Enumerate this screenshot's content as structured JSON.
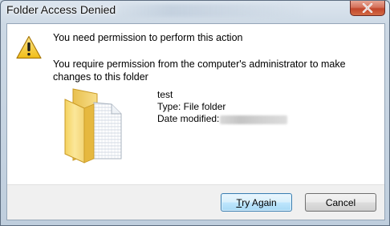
{
  "window": {
    "title": "Folder Access Denied"
  },
  "dialog": {
    "heading": "You need permission to perform this action",
    "message": "You require permission from the computer's administrator to make changes to this folder"
  },
  "item": {
    "name": "test",
    "type_label": "Type: File folder",
    "date_modified_label": "Date modified:",
    "date_modified_value_redacted": true
  },
  "buttons": {
    "try_again_accel": "T",
    "try_again_rest": "ry Again",
    "cancel": "Cancel"
  },
  "icons": {
    "title_close": "close-icon",
    "warning": "warning-icon",
    "folder": "folder-icon"
  },
  "colors": {
    "close_button": "#c9462c",
    "default_button_border": "#3c7fb1",
    "warning_yellow": "#f6d135"
  }
}
